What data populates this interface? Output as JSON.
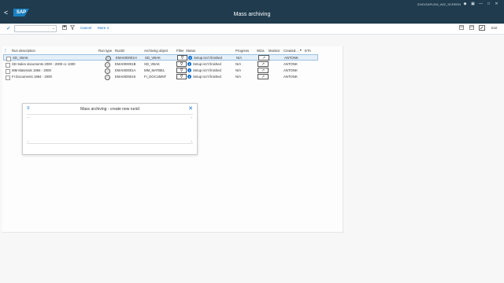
{
  "shell": {
    "back": "<",
    "logo": "SAP",
    "title": "Mass archiving",
    "tcode": "/DVD/SAPLEM_WIZ_SCREEN",
    "window_icons": [
      "◆",
      "▣",
      "—",
      "□",
      "✕"
    ]
  },
  "toolbar": {
    "check": "✓",
    "select_value": "",
    "cancel": "Cancel",
    "more": "More",
    "more_arrow": "∨",
    "exit": "Exit"
  },
  "table": {
    "headers": {
      "run_description": "Run description",
      "run_type": "Run type",
      "runid": "RunID",
      "archiving_object": "Archiving object",
      "filter": "Filter",
      "status": "Status",
      "progress": "Progress",
      "wiza": "Wiza",
      "monitor": "Monitor",
      "created": "Created...",
      "eta": "ETA"
    },
    "rows": [
      {
        "description": "SD_VBAK",
        "runid": "EMA000001H",
        "object": "SD_VBAK",
        "status": "Setup isn't finished",
        "progress": "N/A",
        "created_by": "ANTONK"
      },
      {
        "description": "SD Sales documents 2000 - 2000 cc 1000",
        "runid": "EMA000001B",
        "object": "SD_VBAK",
        "status": "Setup isn't finished",
        "progress": "N/A",
        "created_by": "ANTONK"
      },
      {
        "description": "MM Materials 1994 - 2000",
        "runid": "EMA000001A",
        "object": "MM_MATBEL",
        "status": "Setup isn't finished",
        "progress": "N/A",
        "created_by": "ANTONK"
      },
      {
        "description": "FI Documents 1994 - 2000",
        "runid": "EMA0000019",
        "object": "FI_DOCUMNT",
        "status": "Setup isn't finished",
        "progress": "N/A",
        "created_by": "ANTONK"
      }
    ]
  },
  "dialog": {
    "menu_icon": "≡",
    "title": "Mass archiving - create new runid",
    "close": "✕"
  }
}
